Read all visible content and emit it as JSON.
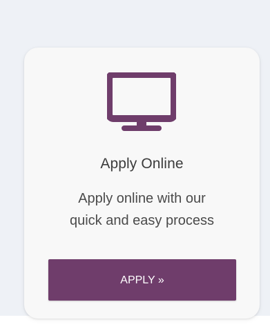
{
  "card": {
    "title": "Apply Online",
    "description_line1": "Apply online with our",
    "description_line2": "quick and easy process",
    "button_label": "APPLY »",
    "icon": "monitor-icon",
    "accent_color": "#6f3d6b"
  }
}
